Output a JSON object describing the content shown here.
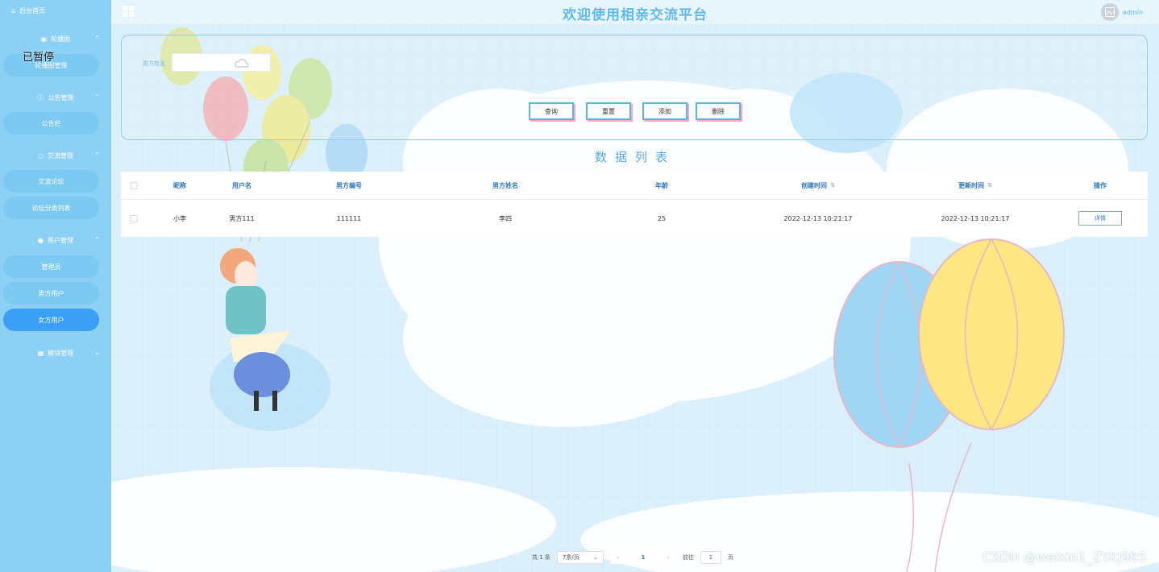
{
  "header": {
    "title": "欢迎使用相亲交流平台",
    "username": "admin"
  },
  "overlay": {
    "paused_text": "已暂停",
    "watermark": "CSDN @weixin1_ZYKJ985"
  },
  "sidebar": {
    "home": "后台首页",
    "groups": [
      {
        "label": "轮播图",
        "items": [
          "轮播图管理"
        ]
      },
      {
        "label": "公告管理",
        "items": [
          "公告栏"
        ]
      },
      {
        "label": "交流管理",
        "items": [
          "交流论坛",
          "论坛分类列表"
        ]
      },
      {
        "label": "用户管理",
        "items": [
          "管理员",
          "男方用户",
          "女方用户"
        ]
      },
      {
        "label": "模块管理",
        "items": []
      }
    ],
    "active_item": "女方用户"
  },
  "search": {
    "field_label": "男方姓名",
    "field_value": ""
  },
  "buttons": {
    "query": "查询",
    "reset": "重置",
    "add": "添加",
    "delete": "删除"
  },
  "list_title": "数据列表",
  "table": {
    "headers": [
      "昵称",
      "用户名",
      "男方编号",
      "男方姓名",
      "年龄",
      "创建时间",
      "更新时间",
      "操作"
    ],
    "rows": [
      {
        "nickname": "小李",
        "username": "男方111",
        "number": "111111",
        "name": "李四",
        "age": "25",
        "created": "2022-12-13 10:21:17",
        "updated": "2022-12-13 10:21:17",
        "action": "详情"
      }
    ]
  },
  "pagination": {
    "total": "共 1 条",
    "page_size": "7条/页",
    "current": "1",
    "goto_label": "前往",
    "goto_value": "1",
    "page_suffix": "页"
  },
  "colors": {
    "sidebar": "#8dd0f5",
    "accent": "#3a9ff5",
    "title": "#5bb8ee"
  }
}
